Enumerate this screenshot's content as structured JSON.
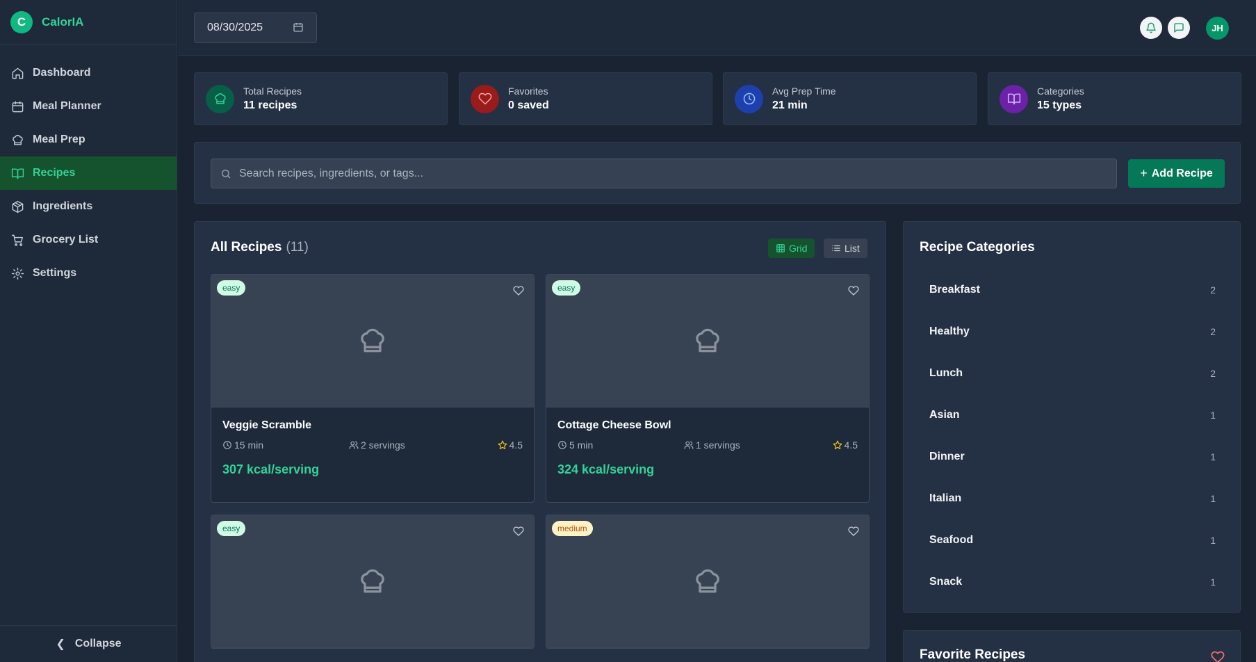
{
  "app": {
    "logo_letter": "C",
    "name": "CalorIA"
  },
  "sidebar": {
    "items": [
      {
        "label": "Dashboard",
        "icon": "home-icon"
      },
      {
        "label": "Meal Planner",
        "icon": "calendar-icon"
      },
      {
        "label": "Meal Prep",
        "icon": "chef-hat-icon"
      },
      {
        "label": "Recipes",
        "icon": "book-open-icon",
        "active": true
      },
      {
        "label": "Ingredients",
        "icon": "package-icon"
      },
      {
        "label": "Grocery List",
        "icon": "cart-icon"
      },
      {
        "label": "Settings",
        "icon": "gear-icon"
      }
    ],
    "collapse_label": "Collapse"
  },
  "topbar": {
    "date": "08/30/2025",
    "user_initials": "JH"
  },
  "stats": [
    {
      "label": "Total Recipes",
      "value": "11 recipes",
      "icon": "chef-hat-icon",
      "bg": "#065f46",
      "stroke": "#34d399"
    },
    {
      "label": "Favorites",
      "value": "0 saved",
      "icon": "heart-icon",
      "bg": "#991b1b",
      "stroke": "#fca5a5"
    },
    {
      "label": "Avg Prep Time",
      "value": "21 min",
      "icon": "clock-icon",
      "bg": "#1e40af",
      "stroke": "#93c5fd"
    },
    {
      "label": "Categories",
      "value": "15 types",
      "icon": "book-open-icon",
      "bg": "#6b21a8",
      "stroke": "#d8b4fe"
    }
  ],
  "search": {
    "placeholder": "Search recipes, ingredients, or tags..."
  },
  "add_button": "Add Recipe",
  "recipes": {
    "title": "All Recipes",
    "count": "(11)",
    "view_grid": "Grid",
    "view_list": "List",
    "cards": [
      {
        "difficulty": "easy",
        "name": "Veggie Scramble",
        "time": "15 min",
        "servings": "2 servings",
        "rating": "4.5",
        "kcal": "307 kcal/serving"
      },
      {
        "difficulty": "easy",
        "name": "Cottage Cheese Bowl",
        "time": "5 min",
        "servings": "1 servings",
        "rating": "4.5",
        "kcal": "324 kcal/serving"
      },
      {
        "difficulty": "easy"
      },
      {
        "difficulty": "medium"
      }
    ]
  },
  "categories": {
    "title": "Recipe Categories",
    "items": [
      {
        "name": "Breakfast",
        "count": "2"
      },
      {
        "name": "Healthy",
        "count": "2"
      },
      {
        "name": "Lunch",
        "count": "2"
      },
      {
        "name": "Asian",
        "count": "1"
      },
      {
        "name": "Dinner",
        "count": "1"
      },
      {
        "name": "Italian",
        "count": "1"
      },
      {
        "name": "Seafood",
        "count": "1"
      },
      {
        "name": "Snack",
        "count": "1"
      }
    ]
  },
  "favorites": {
    "title": "Favorite Recipes"
  },
  "colors": {
    "accent": "#34d399",
    "primary_button": "#047857",
    "background": "#1a2332"
  }
}
